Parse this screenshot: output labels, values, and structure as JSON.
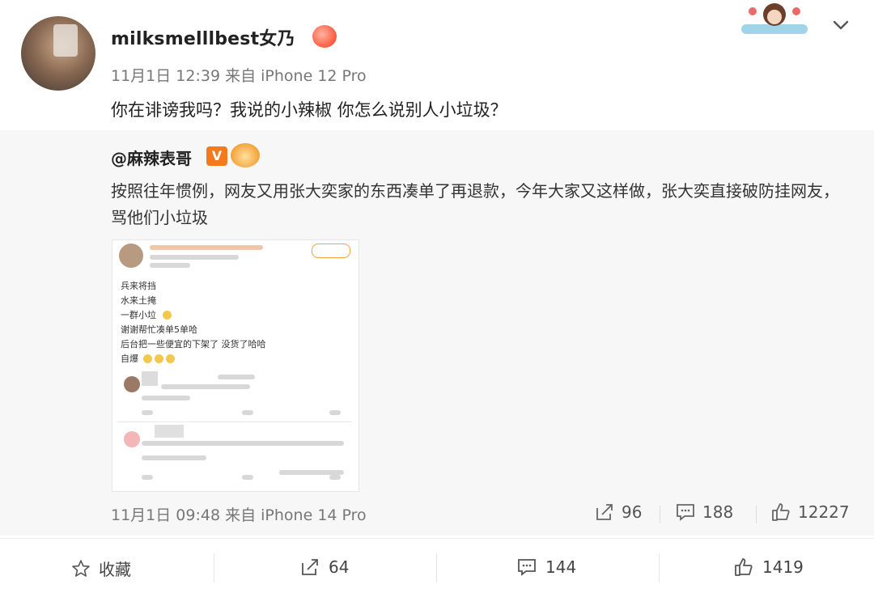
{
  "post": {
    "username": "milksmelllbest女乃",
    "meta": "11月1日 12:39 来自 iPhone 12 Pro",
    "text": "你在诽谤我吗？我说的小辣椒 你怎么说别人小垃圾？"
  },
  "repost": {
    "user": "@麻辣表哥",
    "verified_badge": "V",
    "text": "按照往年惯例，网友又用张大奕家的东西凑单了再退款，今年大家又这样做，张大奕直接破防挂网友，骂他们小垃圾",
    "meta": "11月1日 09:48 来自 iPhone 14 Pro",
    "share_count": "96",
    "comment_count": "188",
    "like_count": "12227"
  },
  "screenshot": {
    "lines": [
      "兵来将挡",
      "水来土掩",
      "一群小垃",
      "谢谢帮忙凑单5单哈",
      "后台把一些便宜的下架了 没货了哈哈",
      "自爆"
    ]
  },
  "footer": {
    "favorite_label": "收藏",
    "share_count": "64",
    "comment_count": "144",
    "like_count": "1419"
  },
  "colors": {
    "accent": "#f37b1d",
    "muted": "#777777",
    "repost_bg": "#f7f7f7"
  }
}
